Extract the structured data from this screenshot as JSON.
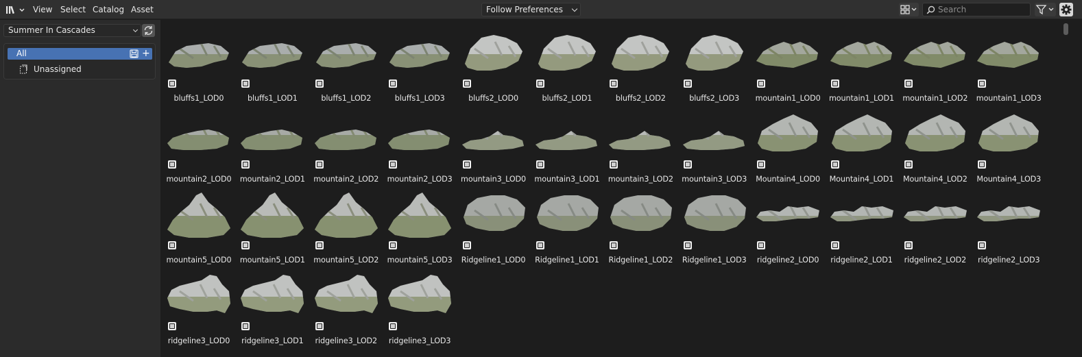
{
  "header": {
    "menus": [
      "View",
      "Select",
      "Catalog",
      "Asset"
    ],
    "import_method": "Follow Preferences",
    "search": {
      "placeholder": "Search",
      "value": ""
    },
    "icons": {
      "editor_type": "asset-browser-icon",
      "display": "grid-display-icon",
      "filter": "funnel-icon",
      "settings": "gear-icon"
    }
  },
  "sidebar": {
    "library": "Summer In Cascades",
    "catalogs": [
      {
        "label": "All",
        "selected": true
      },
      {
        "label": "Unassigned",
        "selected": false
      }
    ]
  },
  "colors": {
    "accent": "#4772b3",
    "background": "#1d1d1d",
    "panel": "#2b2b2b",
    "header": "#303030"
  },
  "assets": [
    {
      "name": "bluffs1_LOD0",
      "shape": "bluffs1"
    },
    {
      "name": "bluffs1_LOD1",
      "shape": "bluffs1"
    },
    {
      "name": "bluffs1_LOD2",
      "shape": "bluffs1"
    },
    {
      "name": "bluffs1_LOD3",
      "shape": "bluffs1"
    },
    {
      "name": "bluffs2_LOD0",
      "shape": "bluffs2"
    },
    {
      "name": "bluffs2_LOD1",
      "shape": "bluffs2"
    },
    {
      "name": "bluffs2_LOD2",
      "shape": "bluffs2"
    },
    {
      "name": "bluffs2_LOD3",
      "shape": "bluffs2"
    },
    {
      "name": "mountain1_LOD0",
      "shape": "mountain1"
    },
    {
      "name": "mountain1_LOD1",
      "shape": "mountain1"
    },
    {
      "name": "mountain1_LOD2",
      "shape": "mountain1"
    },
    {
      "name": "mountain1_LOD3",
      "shape": "mountain1"
    },
    {
      "name": "mountain2_LOD0",
      "shape": "mountain2"
    },
    {
      "name": "mountain2_LOD1",
      "shape": "mountain2"
    },
    {
      "name": "mountain2_LOD2",
      "shape": "mountain2"
    },
    {
      "name": "mountain2_LOD3",
      "shape": "mountain2"
    },
    {
      "name": "mountain3_LOD0",
      "shape": "mountain3"
    },
    {
      "name": "mountain3_LOD1",
      "shape": "mountain3"
    },
    {
      "name": "mountain3_LOD2",
      "shape": "mountain3"
    },
    {
      "name": "mountain3_LOD3",
      "shape": "mountain3"
    },
    {
      "name": "Mountain4_LOD0",
      "shape": "mountain4"
    },
    {
      "name": "Mountain4_LOD1",
      "shape": "mountain4"
    },
    {
      "name": "Mountain4_LOD2",
      "shape": "mountain4"
    },
    {
      "name": "Mountain4_LOD3",
      "shape": "mountain4"
    },
    {
      "name": "mountain5_LOD0",
      "shape": "mountain5"
    },
    {
      "name": "mountain5_LOD1",
      "shape": "mountain5"
    },
    {
      "name": "mountain5_LOD2",
      "shape": "mountain5"
    },
    {
      "name": "mountain5_LOD3",
      "shape": "mountain5"
    },
    {
      "name": "Ridgeline1_LOD0",
      "shape": "ridgeline1"
    },
    {
      "name": "Ridgeline1_LOD1",
      "shape": "ridgeline1"
    },
    {
      "name": "Ridgeline1_LOD2",
      "shape": "ridgeline1"
    },
    {
      "name": "Ridgeline1_LOD3",
      "shape": "ridgeline1"
    },
    {
      "name": "ridgeline2_LOD0",
      "shape": "ridgeline2"
    },
    {
      "name": "ridgeline2_LOD1",
      "shape": "ridgeline2"
    },
    {
      "name": "ridgeline2_LOD2",
      "shape": "ridgeline2"
    },
    {
      "name": "ridgeline2_LOD3",
      "shape": "ridgeline2"
    },
    {
      "name": "ridgeline3_LOD0",
      "shape": "ridgeline3"
    },
    {
      "name": "ridgeline3_LOD1",
      "shape": "ridgeline3"
    },
    {
      "name": "ridgeline3_LOD2",
      "shape": "ridgeline3"
    },
    {
      "name": "ridgeline3_LOD3",
      "shape": "ridgeline3"
    }
  ]
}
